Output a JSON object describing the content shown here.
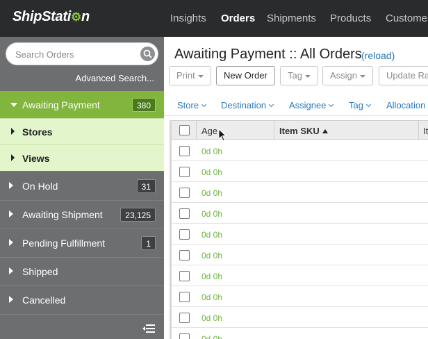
{
  "app": {
    "logo": "ShipStation",
    "nav": [
      "Insights",
      "Orders",
      "Shipments",
      "Products",
      "Customers"
    ],
    "active_nav": "Orders"
  },
  "sidebar": {
    "search_placeholder": "Search Orders",
    "advanced_search": "Advanced Search...",
    "items": [
      {
        "label": "Awaiting Payment",
        "count": "380",
        "expanded": true
      },
      {
        "label": "On Hold",
        "count": "31"
      },
      {
        "label": "Awaiting Shipment",
        "count": "23,125"
      },
      {
        "label": "Pending Fulfillment",
        "count": "1"
      },
      {
        "label": "Shipped",
        "count": ""
      },
      {
        "label": "Cancelled",
        "count": ""
      }
    ],
    "sub_items": [
      "Stores",
      "Views"
    ]
  },
  "main": {
    "title": "Awaiting Payment :: All Orders",
    "reload": "(reload)",
    "toolbar": {
      "print": "Print",
      "new_order": "New Order",
      "tag": "Tag",
      "assign": "Assign",
      "update": "Update Ra"
    },
    "filters": [
      "Store",
      "Destination",
      "Assignee",
      "Tag",
      "Allocation"
    ],
    "table": {
      "columns": [
        "Age",
        "Item SKU",
        "It"
      ],
      "rows": [
        "0d 0h",
        "0d 0h",
        "0d 0h",
        "0d 0h",
        "0d 0h",
        "0d 0h",
        "0d 0h",
        "0d 0h",
        "0d 0h",
        "0d 0h"
      ]
    }
  },
  "colors": {
    "accent_green": "#81b53d",
    "link_blue": "#2a7ab9",
    "nav_bg": "#292b2c",
    "sidebar_bg": "#6c6e70"
  }
}
